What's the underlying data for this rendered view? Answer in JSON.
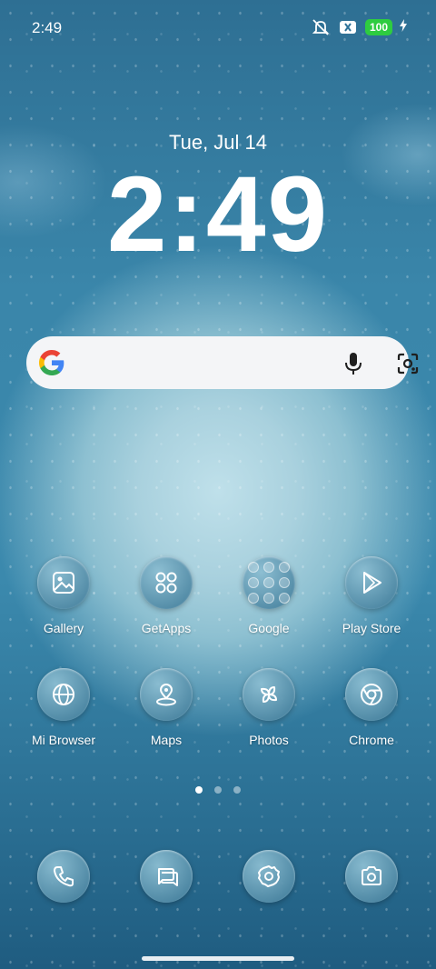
{
  "status_bar": {
    "time": "2:49",
    "battery": "100",
    "icons": [
      "mute-icon",
      "notification-x-icon",
      "battery-icon",
      "charging-icon"
    ]
  },
  "lockclock": {
    "date": "Tue, Jul 14",
    "time": "2:49"
  },
  "search_bar": {
    "icons": [
      "google-logo",
      "mic-icon",
      "lens-icon"
    ]
  },
  "apps": [
    {
      "label": "Gallery",
      "icon": "gallery-icon"
    },
    {
      "label": "GetApps",
      "icon": "getapps-icon"
    },
    {
      "label": "Google",
      "icon": "google-folder-icon"
    },
    {
      "label": "Play Store",
      "icon": "play-store-icon"
    },
    {
      "label": "Mi Browser",
      "icon": "globe-icon"
    },
    {
      "label": "Maps",
      "icon": "map-pin-icon"
    },
    {
      "label": "Photos",
      "icon": "pinwheel-icon"
    },
    {
      "label": "Chrome",
      "icon": "chrome-icon"
    }
  ],
  "page_indicator": {
    "pages": 3,
    "active": 1
  },
  "dock": [
    {
      "icon": "phone-icon"
    },
    {
      "icon": "messages-icon"
    },
    {
      "icon": "settings-icon"
    },
    {
      "icon": "camera-icon"
    }
  ]
}
